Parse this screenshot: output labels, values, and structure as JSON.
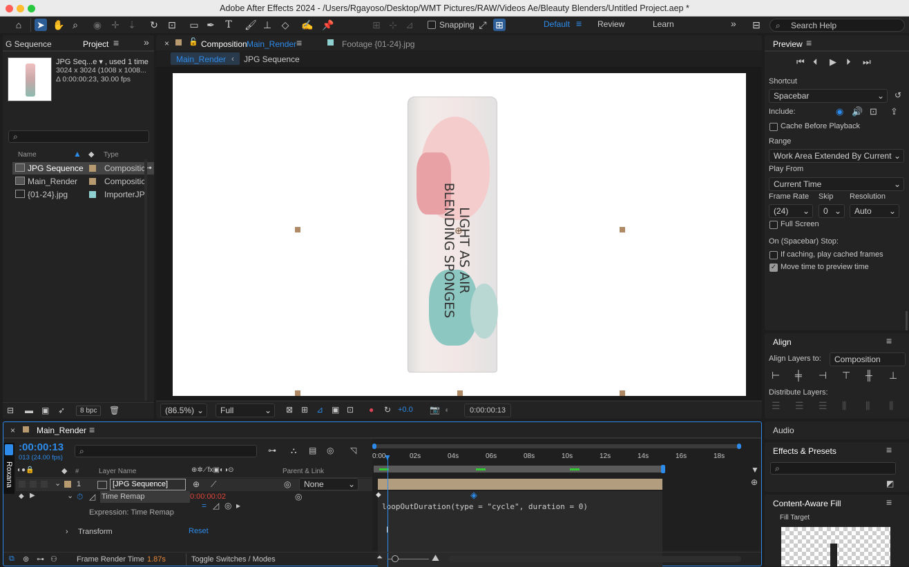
{
  "app": {
    "title": "Adobe After Effects 2024 - /Users/Rgayoso/Desktop/WMT Pictures/RAW/Videos Ae/Bleauty Blenders/Untitled Project.aep *"
  },
  "toolbar": {
    "snapping": "Snapping",
    "workspaces": [
      "Default",
      "Review",
      "Learn"
    ],
    "search_placeholder": "Search Help"
  },
  "project": {
    "tab_left": "G Sequence",
    "tab": "Project",
    "item_name": "JPG Seq...e ▾ , used 1 time",
    "item_dims": "3024 x 3024  (1008 x 1008...",
    "item_dur": "Δ 0:00:00:23, 30.00 fps",
    "col_name": "Name",
    "col_type": "Type",
    "items": [
      {
        "name": "JPG Sequence",
        "type": "Compositic",
        "color": "#b79a70"
      },
      {
        "name": "Main_Render",
        "type": "Compositic",
        "color": "#b79a70"
      },
      {
        "name": "{01-24}.jpg",
        "type": "ImporterJP",
        "color": "#8fd0d0"
      }
    ],
    "bpc": "8 bpc"
  },
  "composition": {
    "tab_prefix": "Composition",
    "tab_name": "Main_Render",
    "footage_tab": "Footage {01-24}.jpg",
    "breadcrumb_main": "Main_Render",
    "breadcrumb_seq": "JPG Sequence",
    "zoom": "(86.5%)",
    "resolution": "Full",
    "exposure": "+0.0",
    "timecode": "0:00:00:13",
    "product_text_1": "LIGHT AS AIR",
    "product_text_2": "BLENDING SPONGES"
  },
  "preview": {
    "title": "Preview",
    "shortcut_label": "Shortcut",
    "shortcut": "Spacebar",
    "include_label": "Include:",
    "cache_before": "Cache Before Playback",
    "range_label": "Range",
    "range": "Work Area Extended By Current ...",
    "play_from_label": "Play From",
    "play_from": "Current Time",
    "frame_rate_label": "Frame Rate",
    "frame_rate": "(24)",
    "skip_label": "Skip",
    "skip": "0",
    "resolution_label": "Resolution",
    "resolution": "Auto",
    "full_screen": "Full Screen",
    "stop_label": "On (Spacebar) Stop:",
    "if_caching": "If caching, play cached frames",
    "move_time": "Move time to preview time"
  },
  "align": {
    "title": "Align",
    "align_to_label": "Align Layers to:",
    "align_to": "Composition",
    "distribute_label": "Distribute Layers:"
  },
  "audio": {
    "title": "Audio"
  },
  "effects": {
    "title": "Effects & Presets"
  },
  "caf": {
    "title": "Content-Aware Fill",
    "target": "Fill Target"
  },
  "timeline": {
    "tab": "Main_Render",
    "timecode": ":00:00:13",
    "fps": "013 (24.00 fps)",
    "side_label": "Roxana",
    "col_layer": "Layer Name",
    "col_parent": "Parent & Link",
    "col_hash": "#",
    "layer_num": "1",
    "layer_name": "[JPG Sequence]",
    "parent": "None",
    "time_remap": "Time Remap",
    "time_remap_val": "0:00:00:02",
    "expression_label": "Expression: Time Remap",
    "expression": "loopOutDuration(type = \"cycle\", duration = 0)",
    "transform": "Transform",
    "reset": "Reset",
    "ruler": [
      "0:00",
      "02s",
      "04s",
      "06s",
      "08s",
      "10s",
      "12s",
      "14s",
      "16s",
      "18s"
    ],
    "frame_render_label": "Frame Render Time",
    "frame_render_val": "1.87s",
    "toggle": "Toggle Switches / Modes"
  }
}
